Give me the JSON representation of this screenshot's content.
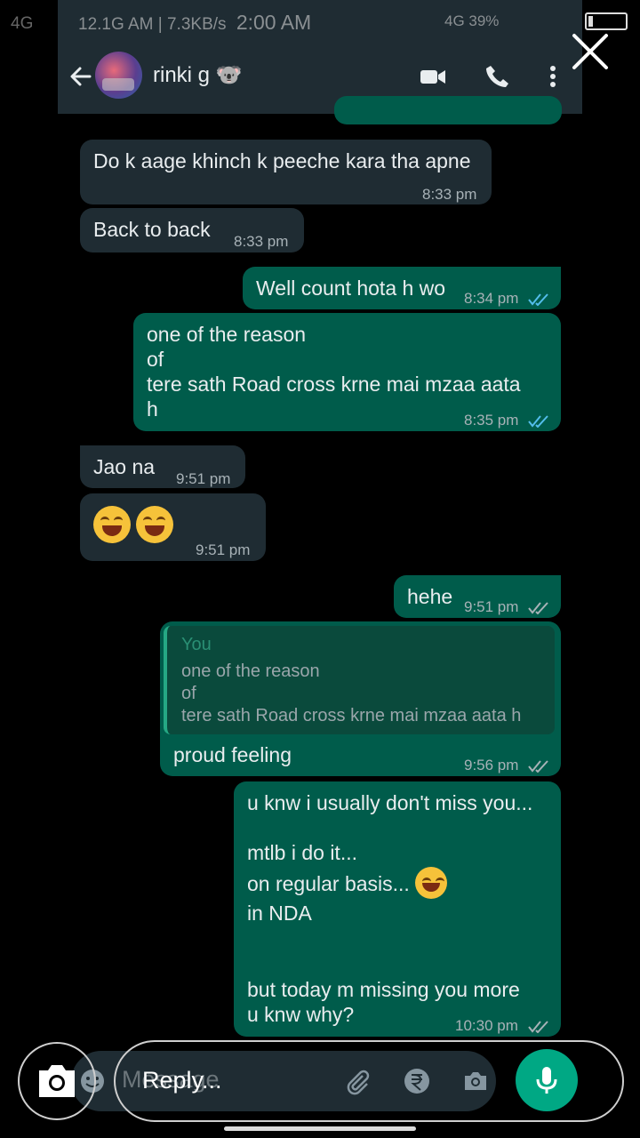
{
  "overlay_status": {
    "network": "4G"
  },
  "inner_status": {
    "left": "12.1G AM | 7.3KB/s",
    "time": "2:00 AM",
    "right": "4G 39%"
  },
  "header": {
    "contact_name": "rinki g 🐨"
  },
  "messages": [
    {
      "dir": "in",
      "lines": [
        "Do k aage khinch k peeche kara tha apne"
      ],
      "time": "8:33 pm"
    },
    {
      "dir": "in",
      "lines": [
        "Back to back"
      ],
      "time": "8:33 pm"
    },
    {
      "dir": "out",
      "lines": [
        "Well count hota h wo"
      ],
      "time": "8:34 pm"
    },
    {
      "dir": "out",
      "lines": [
        "one of the reason",
        "of",
        " tere sath Road cross krne mai mzaa aata",
        "h"
      ],
      "time": "8:35 pm"
    },
    {
      "dir": "in",
      "lines": [
        "Jao na"
      ],
      "time": "9:51 pm"
    },
    {
      "dir": "in",
      "lines": [],
      "time": "9:51 pm"
    },
    {
      "dir": "out",
      "lines": [
        "hehe"
      ],
      "time": "9:51 pm"
    },
    {
      "dir": "out",
      "lines": [
        "proud feeling"
      ],
      "time": "9:56 pm",
      "quote": {
        "author": "You",
        "lines": [
          "one of the reason",
          "of",
          " tere sath Road cross krne mai mzaa aata h"
        ]
      }
    },
    {
      "dir": "out",
      "lines": [
        "u knw i usually don't miss you...",
        "mtlb i do it...",
        "on regular basis...",
        "in NDA",
        "but today m missing you more",
        "u knw why?"
      ],
      "time": "10:30 pm"
    }
  ],
  "composer": {
    "placeholder": "Message",
    "reply_label": "Reply..."
  },
  "colors": {
    "incoming": "#1f2c33",
    "outgoing": "#005c4b",
    "accent": "#00a884",
    "ticks": "#53bdeb"
  },
  "icons": [
    "close-icon",
    "back-arrow-icon",
    "video-call-icon",
    "phone-icon",
    "more-vert-icon",
    "emoji-icon",
    "attach-icon",
    "rupee-icon",
    "camera-icon",
    "mic-icon"
  ]
}
